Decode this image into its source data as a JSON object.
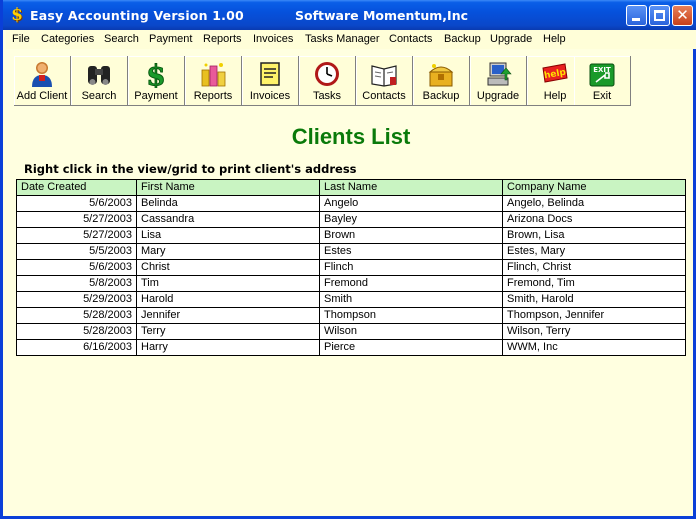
{
  "window": {
    "title": "Easy Accounting Version 1.00",
    "company": "Software Momentum,Inc",
    "minimize_icon": "minimize-icon",
    "maximize_icon": "maximize-icon",
    "close_icon": "close-icon"
  },
  "menu": [
    "File",
    "Categories",
    "Search",
    "Payment",
    "Reports",
    "Invoices",
    "Tasks Manager",
    "Contacts",
    "Backup",
    "Upgrade",
    "Help"
  ],
  "toolbar": [
    {
      "label": "Add Client",
      "icon": "person-icon"
    },
    {
      "label": "Search",
      "icon": "binoculars-icon"
    },
    {
      "label": "Payment",
      "icon": "dollar-icon"
    },
    {
      "label": "Reports",
      "icon": "coins-icon"
    },
    {
      "label": "Invoices",
      "icon": "document-icon"
    },
    {
      "label": "Tasks",
      "icon": "clock-icon"
    },
    {
      "label": "Contacts",
      "icon": "address-book-icon"
    },
    {
      "label": "Backup",
      "icon": "treasure-chest-icon"
    },
    {
      "label": "Upgrade",
      "icon": "computer-icon"
    },
    {
      "label": "Help",
      "icon": "help-icon"
    },
    {
      "label": "Exit",
      "icon": "exit-icon"
    }
  ],
  "main": {
    "heading": "Clients List",
    "hint": "Right click in the view/grid to print client's address"
  },
  "grid": {
    "columns": [
      "Date Created",
      "First Name",
      "Last Name",
      "Company Name"
    ],
    "rows": [
      [
        "5/6/2003",
        "Belinda",
        "Angelo",
        "Angelo, Belinda"
      ],
      [
        "5/27/2003",
        "Cassandra",
        "Bayley",
        "Arizona Docs"
      ],
      [
        "5/27/2003",
        "Lisa",
        "Brown",
        "Brown, Lisa"
      ],
      [
        "5/5/2003",
        "Mary",
        "Estes",
        "Estes, Mary"
      ],
      [
        "5/6/2003",
        "Christ",
        "Flinch",
        "Flinch, Christ"
      ],
      [
        "5/8/2003",
        "Tim",
        "Fremond",
        "Fremond, Tim"
      ],
      [
        "5/29/2003",
        "Harold",
        "Smith",
        "Smith, Harold"
      ],
      [
        "5/28/2003",
        "Jennifer",
        "Thompson",
        "Thompson, Jennifer"
      ],
      [
        "5/28/2003",
        "Terry",
        "Wilson",
        "Wilson, Terry"
      ],
      [
        "6/16/2003",
        "Harry",
        "Pierce",
        "WWM, Inc"
      ]
    ]
  },
  "colors": {
    "background": "#fffed8",
    "heading": "#0a7a0a",
    "grid_header": "#c9f4c2",
    "titlebar": "#0651dc"
  }
}
